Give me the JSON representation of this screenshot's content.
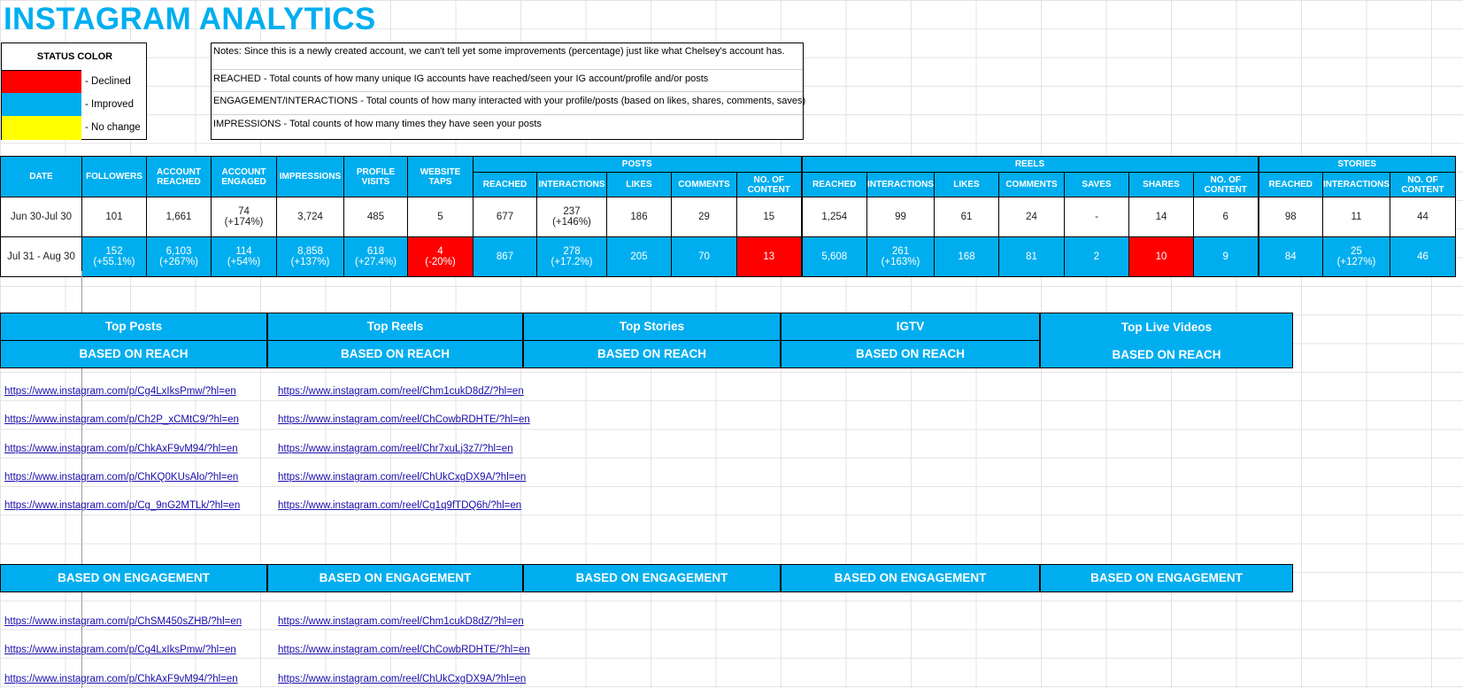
{
  "title": "INSTAGRAM ANALYTICS",
  "legend": {
    "header": "STATUS COLOR",
    "items": [
      {
        "label": "- Declined",
        "color": "#ff0000"
      },
      {
        "label": "- Improved",
        "color": "#00aeef"
      },
      {
        "label": "- No change",
        "color": "#ffff00"
      }
    ]
  },
  "notes": [
    "Notes: Since this is a newly created account, we can't tell yet some improvements (percentage) just like what Chelsey's account has.",
    "REACHED - Total counts of how many unique IG accounts have reached/seen your IG account/profile and/or posts",
    "ENGAGEMENT/INTERACTIONS - Total counts of how many interacted with your profile/posts (based on likes, shares, comments, saves)",
    "IMPRESSIONS - Total counts of how many times they have seen your posts"
  ],
  "stats": {
    "groups": {
      "posts": "POSTS",
      "reels": "REELS",
      "stories": "STORIES"
    },
    "headers": {
      "date": "DATE",
      "followers": "FOLLOWERS",
      "account_reached": "ACCOUNT REACHED",
      "account_engaged": "ACCOUNT ENGAGED",
      "impressions": "IMPRESSIONS",
      "profile_visits": "PROFILE VISITS",
      "website_taps": "WEBSITE TAPS",
      "posts": [
        "REACHED",
        "INTERACTIONS",
        "LIKES",
        "COMMENTS",
        "NO. OF CONTENT"
      ],
      "reels": [
        "REACHED",
        "INTERACTIONS",
        "LIKES",
        "COMMENTS",
        "SAVES",
        "SHARES",
        "NO. OF CONTENT"
      ],
      "stories": [
        "REACHED",
        "INTERACTIONS",
        "NO. OF CONTENT"
      ]
    },
    "rows": [
      {
        "date": "Jun 30-Jul 30",
        "cells": [
          {
            "v": "101"
          },
          {
            "v": "1,661"
          },
          {
            "v": "74",
            "d": "(+174%)"
          },
          {
            "v": "3,724"
          },
          {
            "v": "485"
          },
          {
            "v": "5"
          },
          {
            "v": "677"
          },
          {
            "v": "237",
            "d": "(+146%)"
          },
          {
            "v": "186"
          },
          {
            "v": "29"
          },
          {
            "v": "15"
          },
          {
            "v": "1,254"
          },
          {
            "v": "99"
          },
          {
            "v": "61"
          },
          {
            "v": "24"
          },
          {
            "v": "-"
          },
          {
            "v": "14"
          },
          {
            "v": "6"
          },
          {
            "v": "98"
          },
          {
            "v": "11"
          },
          {
            "v": "44"
          }
        ]
      },
      {
        "date": "Jul 31 - Aug 30",
        "cells": [
          {
            "v": "152",
            "d": "(+55.1%)",
            "s": "improved"
          },
          {
            "v": "6,103",
            "d": "(+267%)",
            "s": "improved"
          },
          {
            "v": "114",
            "d": "(+54%)",
            "s": "improved"
          },
          {
            "v": "8,858",
            "d": "(+137%)",
            "s": "improved"
          },
          {
            "v": "618",
            "d": "(+27.4%)",
            "s": "improved"
          },
          {
            "v": "4",
            "d": "(-20%)",
            "s": "declined"
          },
          {
            "v": "867",
            "s": "improved"
          },
          {
            "v": "278",
            "d": "(+17.2%)",
            "s": "improved"
          },
          {
            "v": "205",
            "s": "improved"
          },
          {
            "v": "70",
            "s": "improved"
          },
          {
            "v": "13",
            "s": "declined"
          },
          {
            "v": "5,608",
            "s": "improved"
          },
          {
            "v": "261",
            "d": "(+163%)",
            "s": "improved"
          },
          {
            "v": "168",
            "s": "improved"
          },
          {
            "v": "81",
            "s": "improved"
          },
          {
            "v": "2",
            "s": "improved"
          },
          {
            "v": "10",
            "s": "declined"
          },
          {
            "v": "9",
            "s": "improved"
          },
          {
            "v": "84",
            "s": "improved"
          },
          {
            "v": "25",
            "d": "(+127%)",
            "s": "improved"
          },
          {
            "v": "46",
            "s": "improved"
          }
        ]
      }
    ]
  },
  "top_blocks": {
    "titles": [
      "Top Posts",
      "Top Reels",
      "Top Stories",
      "IGTV",
      "Top Live Videos"
    ],
    "reach_label": "BASED ON REACH",
    "engagement_label": "BASED ON ENGAGEMENT"
  },
  "links": {
    "posts_reach": [
      "https://www.instagram.com/p/Cg4LxIksPmw/?hl=en",
      "https://www.instagram.com/p/Ch2P_xCMtC9/?hl=en",
      "https://www.instagram.com/p/ChkAxF9vM94/?hl=en",
      "https://www.instagram.com/p/ChKQ0KUsAlo/?hl=en",
      "https://www.instagram.com/p/Cg_9nG2MTLk/?hl=en"
    ],
    "reels_reach": [
      "https://www.instagram.com/reel/Chm1cukD8dZ/?hl=en",
      "https://www.instagram.com/reel/ChCowbRDHTE/?hl=en",
      "https://www.instagram.com/reel/Chr7xuLj3z7/?hl=en",
      "https://www.instagram.com/reel/ChUkCxgDX9A/?hl=en",
      "https://www.instagram.com/reel/Cg1q9fTDQ6h/?hl=en"
    ],
    "posts_engagement": [
      "https://www.instagram.com/p/ChSM450sZHB/?hl=en",
      "https://www.instagram.com/p/Cg4LxIksPmw/?hl=en",
      "https://www.instagram.com/p/ChkAxF9vM94/?hl=en"
    ],
    "reels_engagement": [
      "https://www.instagram.com/reel/Chm1cukD8dZ/?hl=en",
      "https://www.instagram.com/reel/ChCowbRDHTE/?hl=en",
      "https://www.instagram.com/reel/ChUkCxgDX9A/?hl=en"
    ]
  }
}
